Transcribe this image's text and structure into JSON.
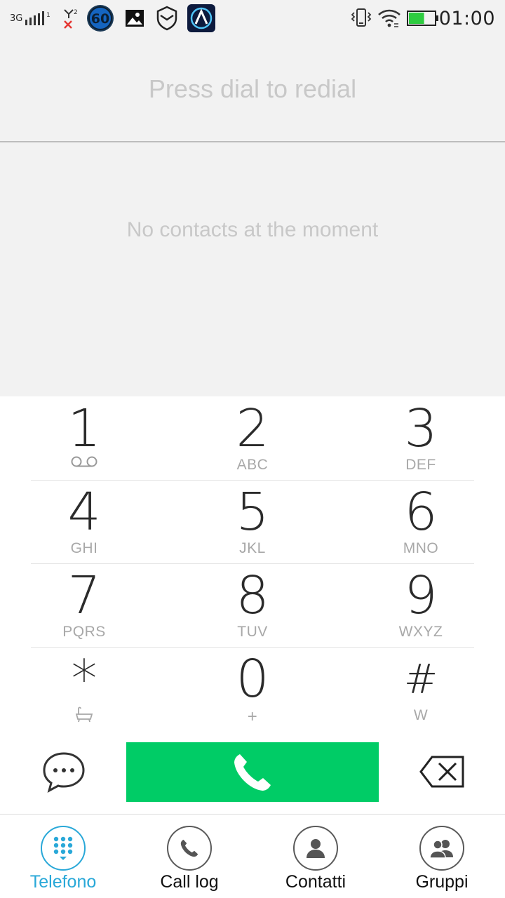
{
  "status_bar": {
    "network_label": "3G",
    "battery_level": 0.6,
    "time": "01:00",
    "notification_badge": "60",
    "icons": [
      "signal-icon",
      "no-signal-sim2-icon",
      "badge-60-icon",
      "gallery-icon",
      "shield-icon",
      "app-a-icon",
      "vibrate-icon",
      "wifi-icon",
      "battery-icon"
    ]
  },
  "redial": {
    "hint": "Press dial to redial"
  },
  "contacts": {
    "empty_message": "No contacts at the moment"
  },
  "keypad": {
    "keys": [
      {
        "digit": "1",
        "letters": ""
      },
      {
        "digit": "2",
        "letters": "ABC"
      },
      {
        "digit": "3",
        "letters": "DEF"
      },
      {
        "digit": "4",
        "letters": "GHI"
      },
      {
        "digit": "5",
        "letters": "JKL"
      },
      {
        "digit": "6",
        "letters": "MNO"
      },
      {
        "digit": "7",
        "letters": "PQRS"
      },
      {
        "digit": "8",
        "letters": "TUV"
      },
      {
        "digit": "9",
        "letters": "WXYZ"
      },
      {
        "digit": "*",
        "letters": ""
      },
      {
        "digit": "0",
        "letters": "+"
      },
      {
        "digit": "#",
        "letters": "W"
      }
    ]
  },
  "actions": {
    "call_color": "#00cc66"
  },
  "bottom_nav": {
    "items": [
      {
        "label": "Telefono",
        "icon": "dialpad-icon",
        "active": true
      },
      {
        "label": "Call log",
        "icon": "phone-icon",
        "active": false
      },
      {
        "label": "Contatti",
        "icon": "person-icon",
        "active": false
      },
      {
        "label": "Gruppi",
        "icon": "group-icon",
        "active": false
      }
    ],
    "accent_color": "#29a8d8"
  }
}
